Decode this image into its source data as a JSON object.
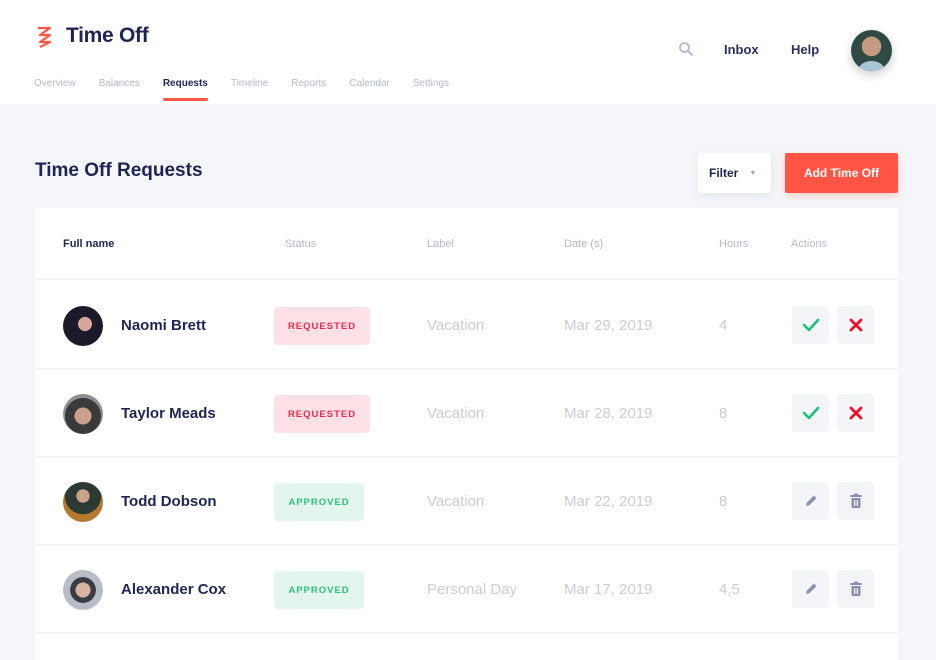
{
  "app": {
    "title": "Time Off",
    "brand_color": "#ff5544"
  },
  "nav": {
    "items": [
      {
        "label": "Overview",
        "active": false
      },
      {
        "label": "Balances",
        "active": false
      },
      {
        "label": "Requests",
        "active": true
      },
      {
        "label": "Timeline",
        "active": false
      },
      {
        "label": "Reports",
        "active": false
      },
      {
        "label": "Calendar",
        "active": false
      },
      {
        "label": "Settings",
        "active": false
      }
    ]
  },
  "header_right": {
    "search_icon": "search-icon",
    "inbox_label": "Inbox",
    "help_label": "Help",
    "avatar": "user-avatar"
  },
  "page": {
    "title": "Time Off Requests",
    "filter_label": "Filter",
    "filter_caret": "▼",
    "add_label": "Add Time Off"
  },
  "table": {
    "columns": [
      "Full name",
      "Status",
      "Label",
      "Date (s)",
      "Hours",
      "Actions"
    ],
    "rows": [
      {
        "name": "Naomi Brett",
        "status": "REQUESTED",
        "status_type": "requested",
        "label": "Vacation",
        "date": "Mar 29, 2019",
        "hours": "4",
        "actions": [
          "approve-icon",
          "reject-icon"
        ]
      },
      {
        "name": "Taylor Meads",
        "status": "REQUESTED",
        "status_type": "requested",
        "label": "Vacation",
        "date": "Mar 28, 2019",
        "hours": "8",
        "actions": [
          "approve-icon",
          "reject-icon"
        ]
      },
      {
        "name": "Todd Dobson",
        "status": "APPROVED",
        "status_type": "approved",
        "label": "Vacation",
        "date": "Mar 22, 2019",
        "hours": "8",
        "actions": [
          "edit-icon",
          "delete-icon"
        ]
      },
      {
        "name": "Alexander Cox",
        "status": "APPROVED",
        "status_type": "approved",
        "label": "Personal Day",
        "date": "Mar 17, 2019",
        "hours": "4,5",
        "actions": [
          "edit-icon",
          "delete-icon"
        ]
      }
    ]
  },
  "colors": {
    "requested_text": "#f02849",
    "requested_bg": "#fde1e6",
    "approved_text": "#2fc07d",
    "approved_bg": "#e2f6ee",
    "approve_icon": "#1fbf77",
    "reject_icon": "#e8112d"
  }
}
